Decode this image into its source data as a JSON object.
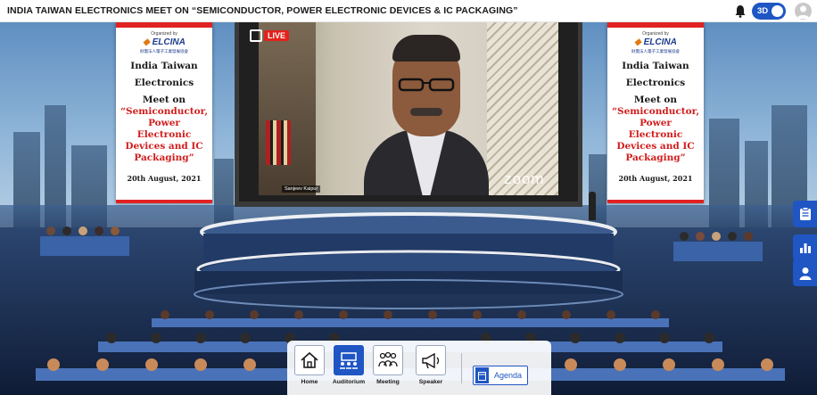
{
  "header": {
    "title": "INDIA TAIWAN ELECTRONICS MEET ON “SEMICONDUCTOR, POWER ELECTRONIC DEVICES & IC PACKAGING”",
    "toggle_label": "3D"
  },
  "banner": {
    "organized_by": "Organized by",
    "logo_text": "ELCINA",
    "sublogo": "財團法人電子工業發展協會",
    "title_line1": "India Taiwan",
    "title_line2": "Electronics",
    "title_line3": "Meet on",
    "topic_line1": "“Semiconductor,",
    "topic_line2": "Power",
    "topic_line3": "Electronic",
    "topic_line4": "Devices and IC",
    "topic_line5": "Packaging”",
    "date": "20th August, 2021"
  },
  "video": {
    "live_label": "LIVE",
    "watermark": "zoom",
    "participant_name": "Sanjeev Kaipur"
  },
  "nav": {
    "items": [
      {
        "label": "Home",
        "icon": "home-icon"
      },
      {
        "label": "Auditorium",
        "icon": "auditorium-icon"
      },
      {
        "label": "Meeting",
        "icon": "meeting-icon"
      },
      {
        "label": "Speaker",
        "icon": "megaphone-icon"
      }
    ],
    "agenda_label": "Agenda",
    "active": "Auditorium"
  },
  "side_buttons": [
    "clipboard-icon",
    "bar-chart-icon",
    "person-icon"
  ],
  "colors": {
    "accent": "#1f56c4",
    "live_red": "#e3221c",
    "banner_red": "#e02222"
  }
}
